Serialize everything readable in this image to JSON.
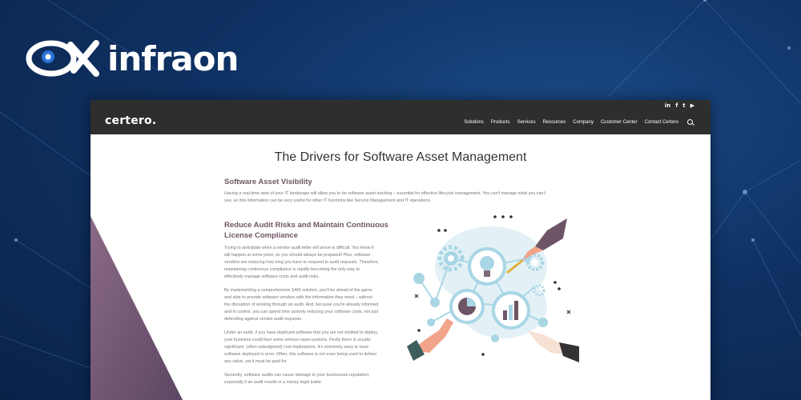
{
  "brand": {
    "name": "infraon"
  },
  "site": {
    "logo": "certero.",
    "social": [
      "in",
      "f",
      "t",
      "▶"
    ],
    "nav": [
      "Solutions",
      "Products",
      "Services",
      "Resources",
      "Company",
      "Customer Center",
      "Contact Certero"
    ]
  },
  "article": {
    "title": "The Drivers for Software Asset Management",
    "section1_heading": "Software Asset Visibility",
    "section1_p1": "Having a real-time view of your IT landscape will allow you to do software asset tracking – essential for effective lifecycle management. You can't manage what you can't",
    "section1_p2": "see, so this information can be very useful for other IT functions like Service Management and IT operations.",
    "section2_heading_line1": "Reduce Audit Risks and Maintain Continuous",
    "section2_heading_line2": "License Compliance",
    "para1": [
      "Trying to anticipate when a vendor audit letter will arrive is difficult. You know it",
      "will happen at some point, so you should always be prepared! Plus, software",
      "vendors are reducing how long you have to respond to audit requests. Therefore,",
      "maintaining continuous compliance is rapidly becoming the only way to",
      "effectively manage software costs and audit risks."
    ],
    "para2": [
      "By implementing a comprehensive SAM solution, you'll be ahead of the game",
      "and able to provide software vendors with the information they need – without",
      "the disruption of working through an audit. And, because you're already informed",
      "and in control, you can spend time actively reducing your software costs, not just",
      "defending against vendor audit requests."
    ],
    "para3": [
      "Under an audit, if you have deployed software that you are not entitled to deploy,",
      "your business could face some serious repercussions. Firstly there is usually",
      "significant, (often unbudgeted) cost implications. It's extremely easy to have",
      "software deployed in error. Often, this software is not even being used to deliver",
      "any value, yet it must be paid for."
    ],
    "para4": [
      "Secondly, software audits can cause damage to your businesses reputation,",
      "especially if an audit results in a messy legal battle."
    ]
  },
  "colors": {
    "nav_bg": "#2e2e2e",
    "heading": "#6e5565",
    "illus_blue": "#a9d6e5"
  }
}
